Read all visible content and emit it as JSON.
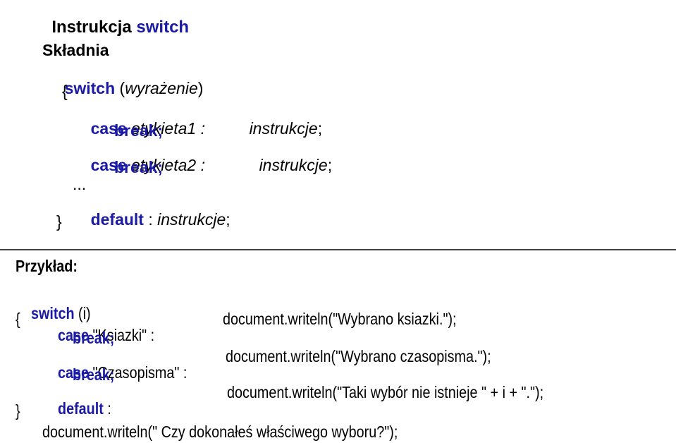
{
  "title": {
    "prefix": "Instrukcja ",
    "keyword": "switch"
  },
  "syntax": {
    "heading": "Składnia",
    "switch_kw": "switch",
    "paren_open": " (",
    "expr": "wyrażenie",
    "paren_close": ")",
    "open_brace": "{",
    "case1_kw": "case",
    "case1_label": " etykieta1 :",
    "case1_instr": "instrukcje",
    "semicolon": ";",
    "break_kw": "break;",
    "case2_kw": "case",
    "case2_label": " etykieta2 :",
    "case2_instr": "instrukcje",
    "ellipsis": "...",
    "default_kw": "default",
    "default_colon": " : ",
    "default_instr": "instrukcje",
    "close_brace": "}"
  },
  "example": {
    "heading": "Przykład:",
    "switch_kw": "switch",
    "switch_arg": " (i)",
    "open_brace": "{",
    "case1_kw": "case",
    "case1_label": " \"Ksiazki\" :",
    "case1_stmt": "document.writeln(\"Wybrano ksiazki.\");",
    "break_kw": "break;",
    "case2_kw": "case",
    "case2_label": " \"Czasopisma\" :",
    "case2_stmt": "document.writeln(\"Wybrano czasopisma.\");",
    "default_kw": "default",
    "default_colon": " :",
    "default_stmt": "document.writeln(\"Taki wybór nie istnieje \" + i + \".\");",
    "close_brace": "}",
    "final_stmt": "document.writeln(\" Czy dokonałeś właściwego wyboru?\");"
  },
  "colors": {
    "keyword": "#1a1aa6",
    "text": "#000000",
    "rule": "#444444"
  }
}
